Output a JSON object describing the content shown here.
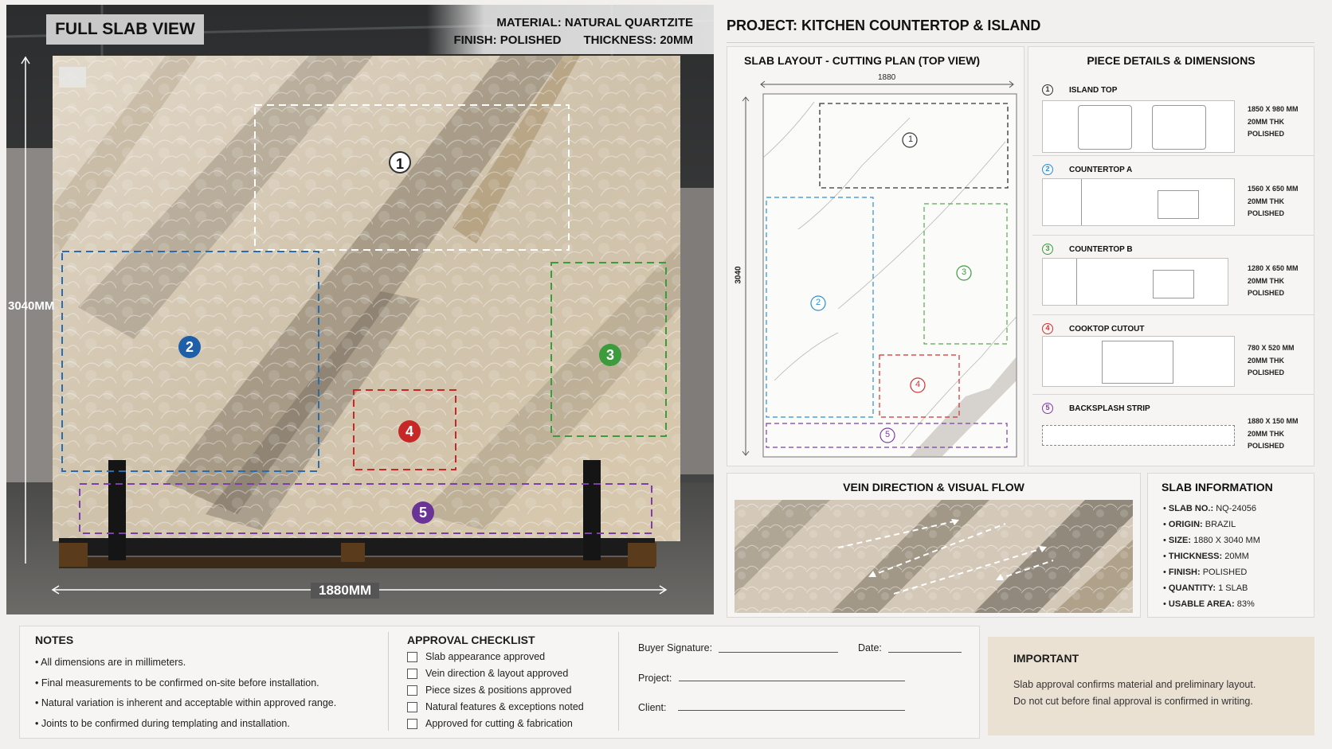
{
  "photo": {
    "title": "FULL SLAB VIEW",
    "material": "MATERIAL: NATURAL QUARTZITE",
    "finish": "FINISH: POLISHED",
    "thickness": "THICKNESS: 20MM",
    "height_label": "3040MM",
    "width_label": "1880MM",
    "markers": [
      "1",
      "2",
      "3",
      "4",
      "5"
    ]
  },
  "project": {
    "title": "PROJECT: KITCHEN COUNTERTOP & ISLAND"
  },
  "layout": {
    "title": "SLAB LAYOUT - CUTTING PLAN (TOP VIEW)",
    "width_dim": "1880",
    "height_dim": "3040",
    "markers": [
      "1",
      "2",
      "3",
      "4",
      "5"
    ]
  },
  "pieces": {
    "title": "PIECE DETAILS & DIMENSIONS",
    "items": [
      {
        "num": "1",
        "name": "ISLAND TOP",
        "size": "1850 X 980 MM",
        "thk": "20MM THK",
        "finish": "POLISHED",
        "color": "#333333"
      },
      {
        "num": "2",
        "name": "COUNTERTOP A",
        "size": "1560 X 650 MM",
        "thk": "20MM THK",
        "finish": "POLISHED",
        "color": "#2b8fd6"
      },
      {
        "num": "3",
        "name": "COUNTERTOP B",
        "size": "1280 X 650 MM",
        "thk": "20MM THK",
        "finish": "POLISHED",
        "color": "#3c9b3c"
      },
      {
        "num": "4",
        "name": "COOKTOP CUTOUT",
        "size": "780 X 520 MM",
        "thk": "20MM THK",
        "finish": "POLISHED",
        "color": "#d32f2f"
      },
      {
        "num": "5",
        "name": "BACKSPLASH STRIP",
        "size": "1880 X 150 MM",
        "thk": "20MM THK",
        "finish": "POLISHED",
        "color": "#7b3fa8"
      }
    ]
  },
  "vein": {
    "title": "VEIN DIRECTION & VISUAL FLOW"
  },
  "slab_info": {
    "title": "SLAB INFORMATION",
    "items": [
      {
        "label": "SLAB NO.:",
        "value": "NQ-24056"
      },
      {
        "label": "ORIGIN:",
        "value": "BRAZIL"
      },
      {
        "label": "SIZE:",
        "value": "1880 X 3040 MM"
      },
      {
        "label": "THICKNESS:",
        "value": "20MM"
      },
      {
        "label": "FINISH:",
        "value": "POLISHED"
      },
      {
        "label": "QUANTITY:",
        "value": "1 SLAB"
      },
      {
        "label": "USABLE AREA:",
        "value": "83%"
      }
    ]
  },
  "notes": {
    "title": "NOTES",
    "items": [
      "All dimensions are in millimeters.",
      "Final measurements to be confirmed on-site before installation.",
      "Natural variation is inherent and acceptable within approved range.",
      "Joints to be confirmed during templating and installation."
    ]
  },
  "checklist": {
    "title": "APPROVAL CHECKLIST",
    "items": [
      "Slab appearance approved",
      "Vein direction & layout approved",
      "Piece sizes & positions approved",
      "Natural features & exceptions noted",
      "Approved for cutting & fabrication"
    ]
  },
  "signature": {
    "buyer": "Buyer Signature:",
    "date": "Date:",
    "project": "Project:",
    "client": "Client:"
  },
  "important": {
    "title": "IMPORTANT",
    "line1": "Slab approval confirms material and preliminary layout.",
    "line2": "Do not cut before final approval is confirmed in writing."
  },
  "colors": {
    "piece1": "#333333",
    "piece2": "#2b6cb0",
    "piece3": "#3c9b3c",
    "piece4": "#c62828",
    "piece5": "#7b3fa8",
    "important_bg": "#ebe1d3"
  }
}
